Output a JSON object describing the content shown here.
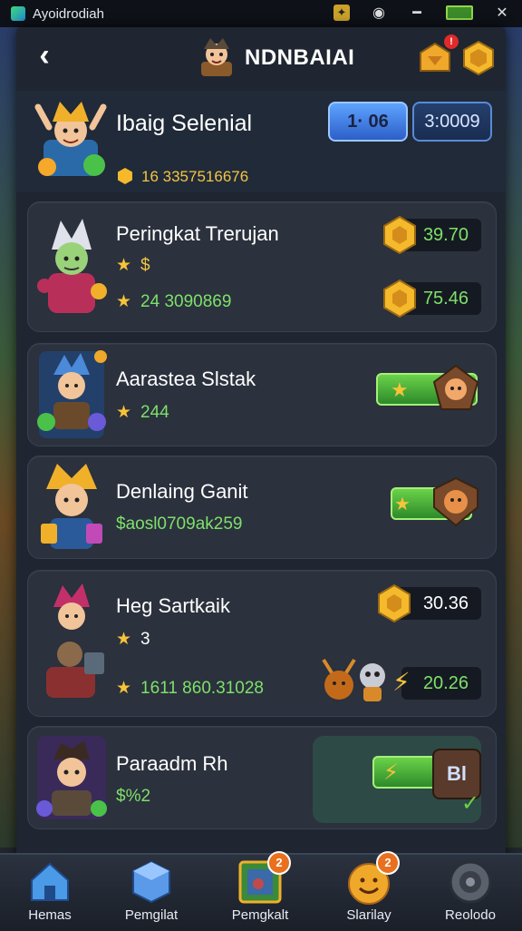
{
  "statusbar": {
    "app_name": "Ayoidrodiah"
  },
  "header": {
    "title": "NDNBAIAI",
    "notif_count": "!"
  },
  "profile": {
    "name": "Ibaig Selenial",
    "score": "16 3357516676",
    "pill1": "1· 06",
    "pill2": "3:0009"
  },
  "cards": [
    {
      "title": "Peringkat Trerujan",
      "sub1": "$",
      "sub2": "24 3090869",
      "val1": "39.70",
      "val2": "75.46"
    },
    {
      "title": "Aarastea Slstak",
      "sub": "244"
    },
    {
      "title": "Denlaing Ganit",
      "sub": "$aosl0709ak259"
    },
    {
      "title": "Heg Sartkaik",
      "sub1": "3",
      "sub2": "1611 860.31028",
      "val1": "30.36",
      "val2": "20.26"
    },
    {
      "title": "Paraadm Rh",
      "sub": "$%2",
      "badge": "Bl"
    }
  ],
  "nav": [
    {
      "label": "Hemas",
      "icon": "home-icon"
    },
    {
      "label": "Pemgilat",
      "icon": "box-icon"
    },
    {
      "label": "Pemgkalt",
      "icon": "picture-card-icon",
      "badge": "2"
    },
    {
      "label": "Slarilay",
      "icon": "smiley-icon",
      "badge": "2"
    },
    {
      "label": "Reolodo",
      "icon": "settings-disc-icon"
    }
  ],
  "colors": {
    "accent_green": "#7ee06a",
    "gold": "#f3c545",
    "panel": "#1f2631",
    "card": "#2b313d"
  }
}
